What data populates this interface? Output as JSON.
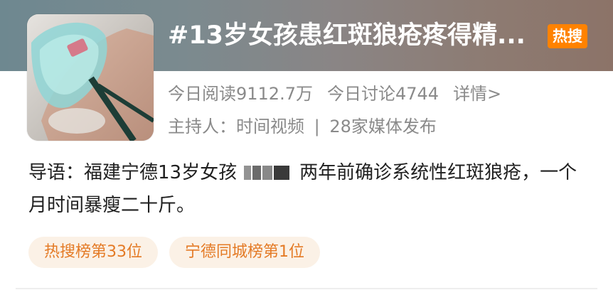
{
  "topic": {
    "title": "#13岁女孩患红斑狼疮疼得精...",
    "badge": "热搜",
    "colors": {
      "badge_bg": "#ff8200",
      "tag_bg": "#fbf1e6",
      "tag_text": "#e47a25"
    }
  },
  "stats": {
    "reads": "今日阅读9112.7万",
    "discussions": "今日讨论4744",
    "details_link": "详情>"
  },
  "host": {
    "label": "主持人：时间视频",
    "separator": "|",
    "media": "28家媒体发布"
  },
  "intro": {
    "part1": "导语：福建宁德13岁女孩",
    "part2": "两年前确诊系统性红斑狼疮，一个月时间暴瘦二十斤。"
  },
  "tags": [
    {
      "label": "热搜榜第33位"
    },
    {
      "label": "宁德同城榜第1位"
    }
  ],
  "thumbnail": {
    "icon": "patient-oxygen-mask-photo"
  }
}
